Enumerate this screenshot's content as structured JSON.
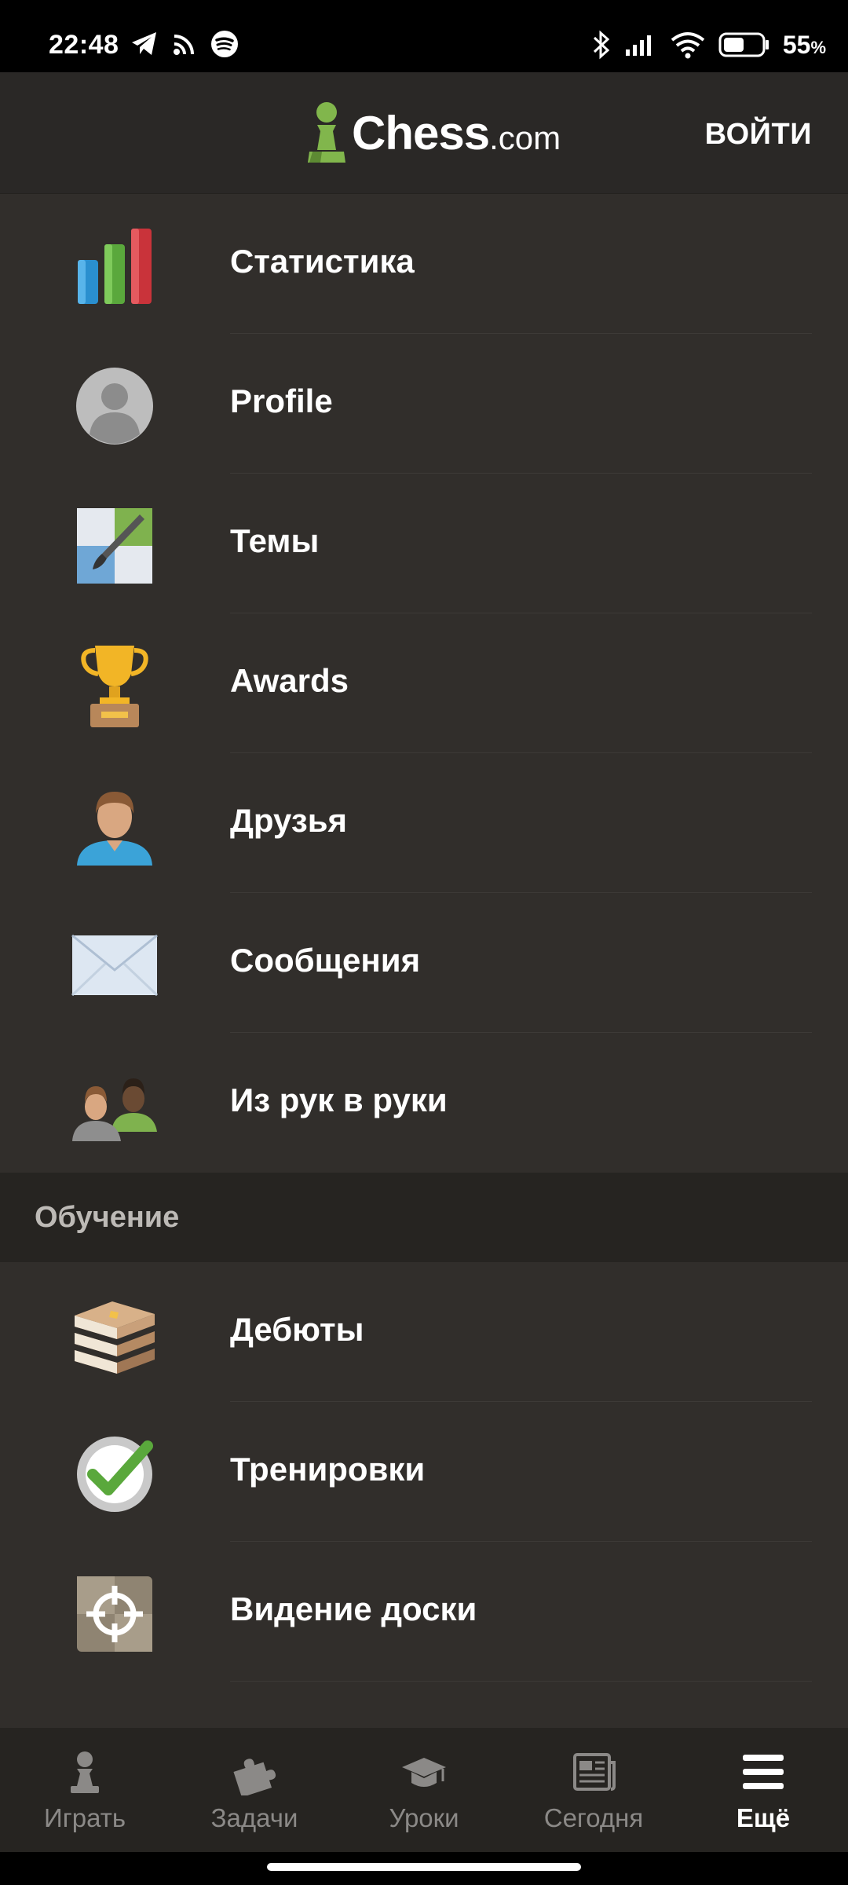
{
  "status_bar": {
    "time": "22:48",
    "battery_pct": "55",
    "battery_unit": "%",
    "battery_level": 0.55,
    "left_icons": [
      "telegram-icon",
      "cast-icon",
      "spotify-icon"
    ],
    "right_icons": [
      "bluetooth-icon",
      "signal-icon",
      "wifi-icon",
      "battery-icon"
    ]
  },
  "header": {
    "logo_text": "Chess",
    "logo_domain": ".com",
    "login_label": "ВОЙТИ"
  },
  "menu_items": [
    {
      "label": "Статистика",
      "icon": "stats-icon"
    },
    {
      "label": "Profile",
      "icon": "profile-avatar-icon"
    },
    {
      "label": "Темы",
      "icon": "themes-icon"
    },
    {
      "label": "Awards",
      "icon": "trophy-icon"
    },
    {
      "label": "Друзья",
      "icon": "friends-icon"
    },
    {
      "label": "Сообщения",
      "icon": "envelope-icon"
    },
    {
      "label": "Из рук в руки",
      "icon": "hand-to-hand-icon"
    }
  ],
  "section_learning": {
    "title": "Обучение",
    "items": [
      {
        "label": "Дебюты",
        "icon": "openings-books-icon"
      },
      {
        "label": "Тренировки",
        "icon": "drills-check-icon"
      },
      {
        "label": "Видение доски",
        "icon": "vision-crosshair-icon"
      }
    ]
  },
  "bottom_nav": [
    {
      "label": "Играть",
      "icon": "pawn-icon",
      "active": false
    },
    {
      "label": "Задачи",
      "icon": "puzzle-icon",
      "active": false
    },
    {
      "label": "Уроки",
      "icon": "graduation-cap-icon",
      "active": false
    },
    {
      "label": "Сегодня",
      "icon": "newspaper-icon",
      "active": false
    },
    {
      "label": "Ещё",
      "icon": "hamburger-menu-icon",
      "active": true
    }
  ],
  "colors": {
    "background": "#312e2b",
    "header": "#2a2826",
    "section_header": "#262421",
    "brand_green": "#81b64c",
    "inactive_nav": "#8b8987"
  }
}
